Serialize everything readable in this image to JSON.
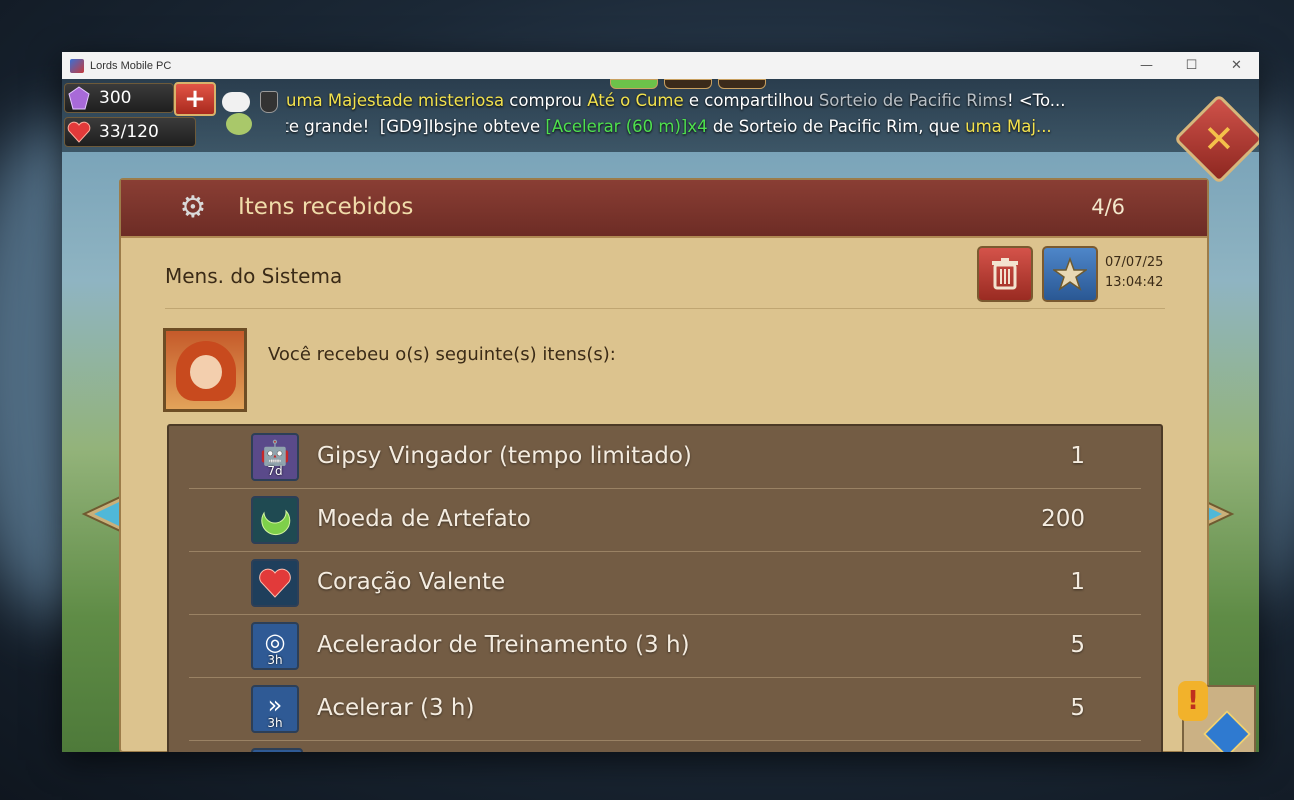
{
  "window": {
    "title": "Lords Mobile PC",
    "controls": {
      "minimize": "—",
      "maximize": "☐",
      "close": "✕"
    }
  },
  "hud": {
    "gems": "300",
    "stamina": "33/120",
    "add_symbol": "+",
    "chat": {
      "line1": [
        {
          "text": "uma Majestade misteriosa",
          "color": "yellow"
        },
        {
          "text": " comprou ",
          "color": "white"
        },
        {
          "text": "Até o Cume",
          "color": "yellow"
        },
        {
          "text": " e compartilhou ",
          "color": "white"
        },
        {
          "text": "Sorteio de Pacific Rims",
          "color": "gray"
        },
        {
          "text": "! <To...",
          "color": "white"
        }
      ],
      "line2": [
        {
          "text": "Sorte grande!  ",
          "color": "white"
        },
        {
          "text": "[GD9]Ibsjne",
          "color": "white"
        },
        {
          "text": " obteve ",
          "color": "white"
        },
        {
          "text": "[Acelerar (60 m)]x4",
          "color": "green"
        },
        {
          "text": " de Sorteio de Pacific Rim, que ",
          "color": "white"
        },
        {
          "text": "uma Maj...",
          "color": "yellow"
        }
      ]
    }
  },
  "panel": {
    "title": "Itens recebidos",
    "count": "4/6",
    "sender": "Mens. do Sistema",
    "date": "07/07/25",
    "time": "13:04:42",
    "intro": "Você recebeu o(s) seguinte(s) itens(s):"
  },
  "items": [
    {
      "name": "Gipsy Vingador (tempo limitado)",
      "qty": "1",
      "badge": "7d",
      "icon": "mech-icon",
      "bg": "#5a4a8a"
    },
    {
      "name": "Moeda de Artefato",
      "qty": "200",
      "badge": "",
      "icon": "artifact-coin-icon",
      "bg": "#1f4a52"
    },
    {
      "name": "Coração Valente",
      "qty": "1",
      "badge": "",
      "icon": "heart-icon",
      "bg": "#1f3f5c"
    },
    {
      "name": "Acelerador de Treinamento (3 h)",
      "qty": "5",
      "badge": "3h",
      "icon": "training-speedup-icon",
      "bg": "#2f5a95"
    },
    {
      "name": "Acelerar (3 h)",
      "qty": "5",
      "badge": "3h",
      "icon": "speedup-icon",
      "bg": "#2f5a95"
    }
  ],
  "colors": {
    "yellow": "#f3e24d",
    "gray": "#b9c0c6",
    "green": "#4ee04e",
    "white": "#ffffff"
  }
}
